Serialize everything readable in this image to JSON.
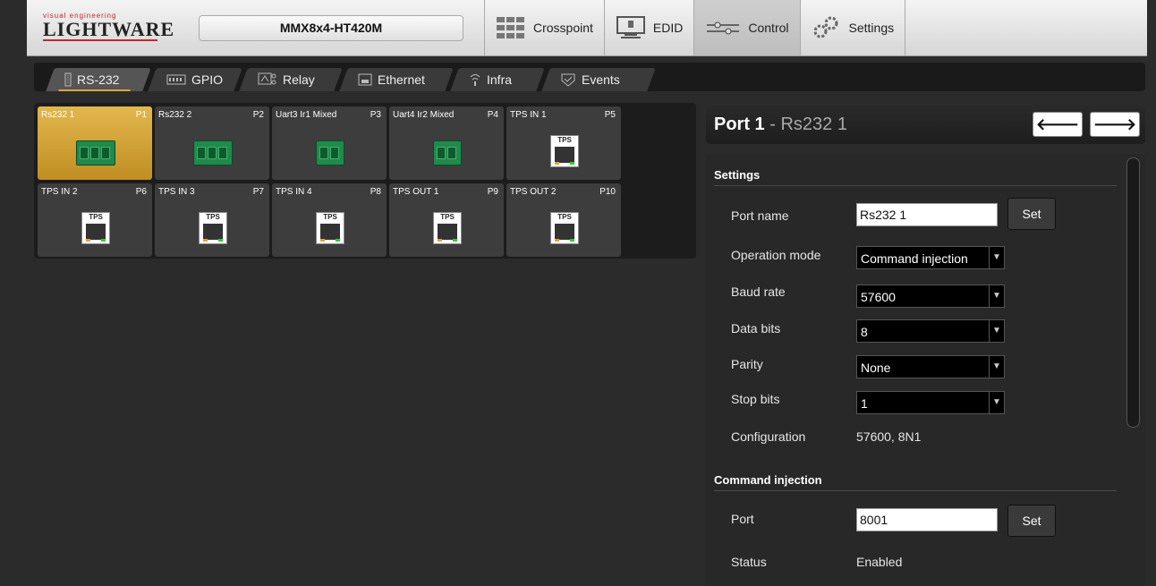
{
  "app": {
    "logo_tagline": "visual engineering",
    "logo_name": "LIGHTWARE",
    "device_name": "MMX8x4-HT420M"
  },
  "nav": {
    "tabs": [
      {
        "label": "Crosspoint",
        "icon": "crosspoint-grid-icon"
      },
      {
        "label": "EDID",
        "icon": "monitor-icon"
      },
      {
        "label": "Control",
        "icon": "sliders-icon"
      },
      {
        "label": "Settings",
        "icon": "gears-icon"
      }
    ],
    "active": "Control"
  },
  "subtabs": [
    {
      "label": "RS-232",
      "icon": "serial-port-icon"
    },
    {
      "label": "GPIO",
      "icon": "gpio-icon"
    },
    {
      "label": "Relay",
      "icon": "relay-icon"
    },
    {
      "label": "Ethernet",
      "icon": "ethernet-icon"
    },
    {
      "label": "Infra",
      "icon": "infrared-icon"
    },
    {
      "label": "Events",
      "icon": "events-icon"
    }
  ],
  "active_subtab": "RS-232",
  "ports": [
    {
      "name": "Rs232 1",
      "port": "P1",
      "type": "serial3"
    },
    {
      "name": "Rs232 2",
      "port": "P2",
      "type": "serial3"
    },
    {
      "name": "Uart3 Ir1 Mixed",
      "port": "P3",
      "type": "serial2"
    },
    {
      "name": "Uart4 Ir2 Mixed",
      "port": "P4",
      "type": "serial2"
    },
    {
      "name": "TPS IN 1",
      "port": "P5",
      "type": "tps"
    },
    {
      "name": "TPS IN 2",
      "port": "P6",
      "type": "tps"
    },
    {
      "name": "TPS IN 3",
      "port": "P7",
      "type": "tps"
    },
    {
      "name": "TPS IN 4",
      "port": "P8",
      "type": "tps"
    },
    {
      "name": "TPS OUT 1",
      "port": "P9",
      "type": "tps"
    },
    {
      "name": "TPS OUT 2",
      "port": "P10",
      "type": "tps"
    }
  ],
  "tps_label": "TPS",
  "detail": {
    "title_prefix": "Port 1",
    "title_sep": " - ",
    "title_name": "Rs232 1",
    "prev_arrow": "🡐",
    "next_arrow": "🡒",
    "settings_header": "Settings",
    "port_name_label": "Port name",
    "port_name_value": "Rs232 1",
    "set_label": "Set",
    "operation_mode_label": "Operation mode",
    "operation_mode_value": "Command injection",
    "baud_rate_label": "Baud rate",
    "baud_rate_value": "57600",
    "data_bits_label": "Data bits",
    "data_bits_value": "8",
    "parity_label": "Parity",
    "parity_value": "None",
    "stop_bits_label": "Stop bits",
    "stop_bits_value": "1",
    "configuration_label": "Configuration",
    "configuration_value": "57600, 8N1",
    "cmd_header": "Command injection",
    "cmd_port_label": "Port",
    "cmd_port_value": "8001",
    "status_label": "Status",
    "status_value": "Enabled"
  },
  "colors": {
    "accent": "#d8a640",
    "connector_green": "#1f8a4a",
    "brand_red": "#c0272d"
  }
}
